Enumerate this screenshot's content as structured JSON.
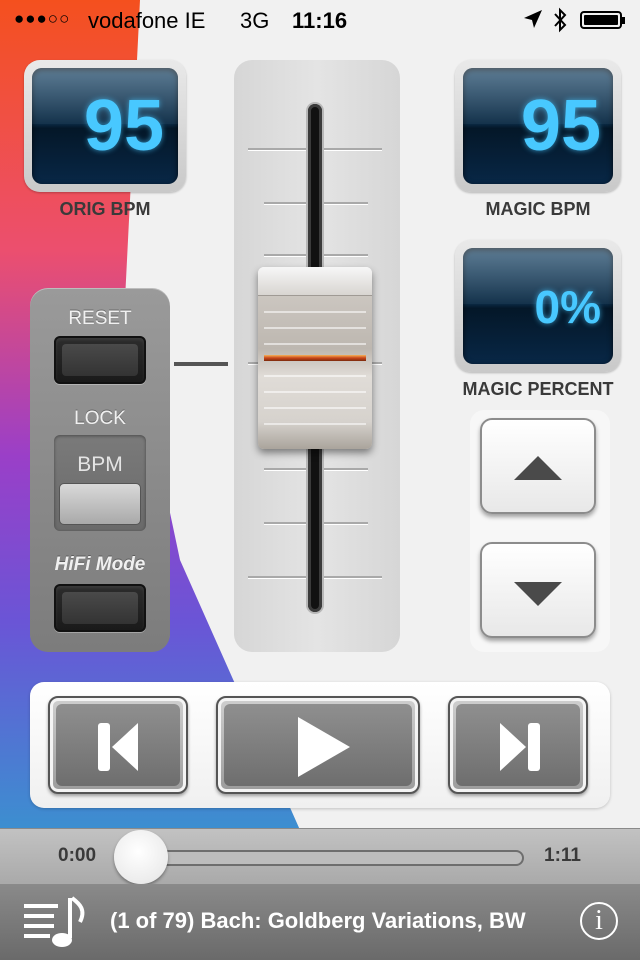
{
  "status_bar": {
    "signal_icon": "signal-dots-icon",
    "signal": "●●●○○",
    "carrier": "vodafone IE",
    "network": "3G",
    "time": "11:16",
    "location_icon": "location-arrow-icon",
    "bluetooth_icon": "bluetooth-icon",
    "battery_icon": "battery-icon"
  },
  "orig_bpm": {
    "value": "95",
    "label": "ORIG BPM"
  },
  "magic_bpm": {
    "value": "95",
    "label": "MAGIC BPM"
  },
  "magic_percent": {
    "value": "0%",
    "label": "MAGIC PERCENT"
  },
  "controls": {
    "reset_label": "RESET",
    "lock_label": "LOCK",
    "bpm_label": "BPM",
    "hifi_label": "HiFi Mode"
  },
  "fader": {
    "level": 0.5
  },
  "arrows": {
    "up_icon": "triangle-up-icon",
    "down_icon": "triangle-down-icon"
  },
  "transport": {
    "prev_icon": "skip-previous-icon",
    "play_icon": "play-icon",
    "next_icon": "skip-next-icon"
  },
  "playback": {
    "current_time": "0:00",
    "total_time": "1:11",
    "progress": 0.0
  },
  "now_playing": {
    "library_icon": "music-library-icon",
    "title": "(1 of 79) Bach: Goldberg Variations, BW",
    "info_icon": "info-icon",
    "info_symbol": "i"
  },
  "colors": {
    "lcd_text": "#48c8ff",
    "background_gradient": [
      "#f4501e",
      "#8a3fc8",
      "#3c8fd0"
    ]
  }
}
